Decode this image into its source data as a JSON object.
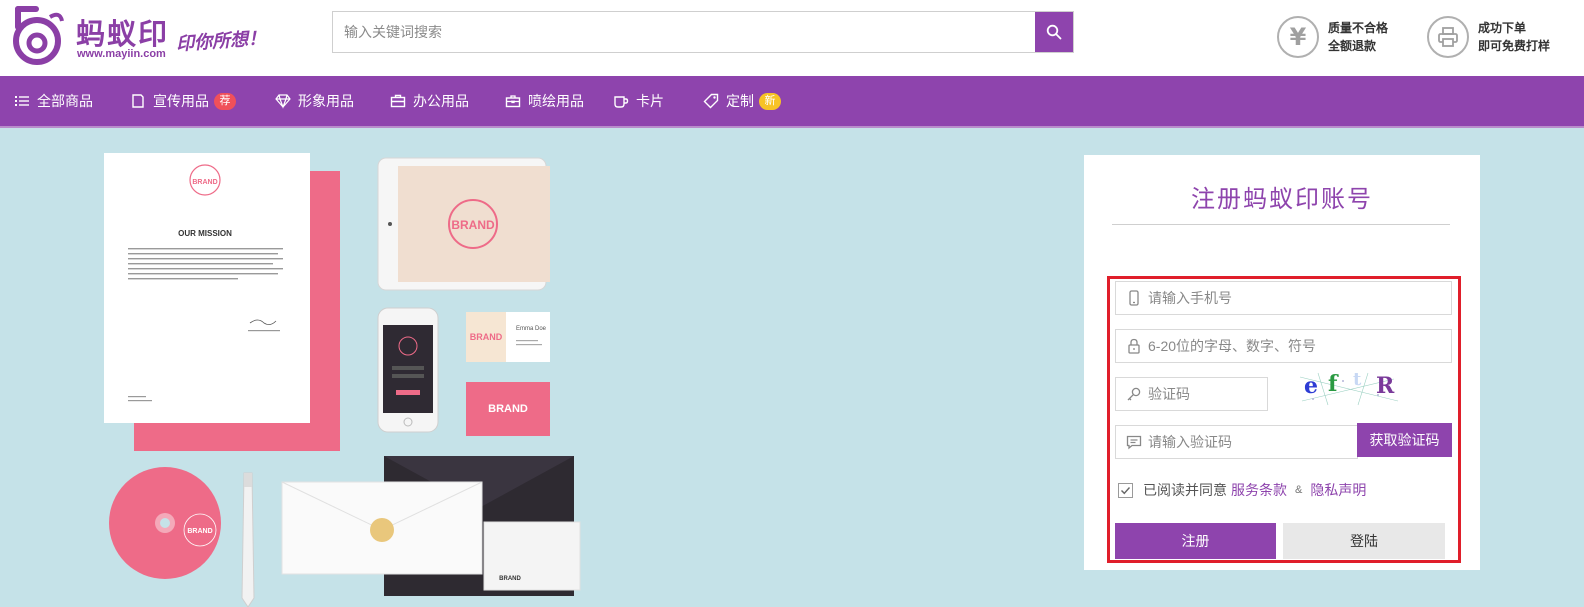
{
  "header": {
    "logo_name": "蚂蚁印",
    "logo_url": "www.mayiin.com",
    "slogan": "印你所想！",
    "search_placeholder": "输入关键词搜索",
    "promises": [
      {
        "icon": "yen-icon",
        "symbol": "¥",
        "line1": "质量不合格",
        "line2": "全额退款"
      },
      {
        "icon": "printer-icon",
        "line1": "成功下单",
        "line2": "即可免费打样"
      }
    ]
  },
  "nav": {
    "items": [
      {
        "label": "全部商品",
        "icon": "list-icon"
      },
      {
        "label": "宣传用品",
        "icon": "page-icon",
        "badge": "荐",
        "badge_color": "#f0505a"
      },
      {
        "label": "形象用品",
        "icon": "diamond-icon"
      },
      {
        "label": "办公用品",
        "icon": "briefcase-icon"
      },
      {
        "label": "喷绘用品",
        "icon": "toolbox-icon"
      },
      {
        "label": "卡片",
        "icon": "cup-icon"
      },
      {
        "label": "定制",
        "icon": "tag-icon",
        "badge": "新",
        "badge_color": "#f7c326"
      }
    ]
  },
  "banner": {
    "letter_heading": "OUR MISSION",
    "brand_text": "BRAND",
    "card_name": "Emma Doe"
  },
  "register": {
    "title": "注册蚂蚁印账号",
    "phone_placeholder": "请输入手机号",
    "password_placeholder": "6-20位的字母、数字、符号",
    "captcha_placeholder": "验证码",
    "captcha_chars": [
      "e",
      "f",
      "t",
      "R"
    ],
    "sms_placeholder": "请输入验证码",
    "sms_button": "获取验证码",
    "agree_text": "已阅读并同意",
    "terms_link": "服务条款",
    "amp": "&",
    "privacy_link": "隐私声明",
    "register_button": "注册",
    "login_button": "登陆"
  },
  "colors": {
    "brand_purple": "#8e44ad",
    "banner_bg": "#c5e2e8",
    "highlight_red": "#e01e2a",
    "pink": "#ee6b88"
  }
}
